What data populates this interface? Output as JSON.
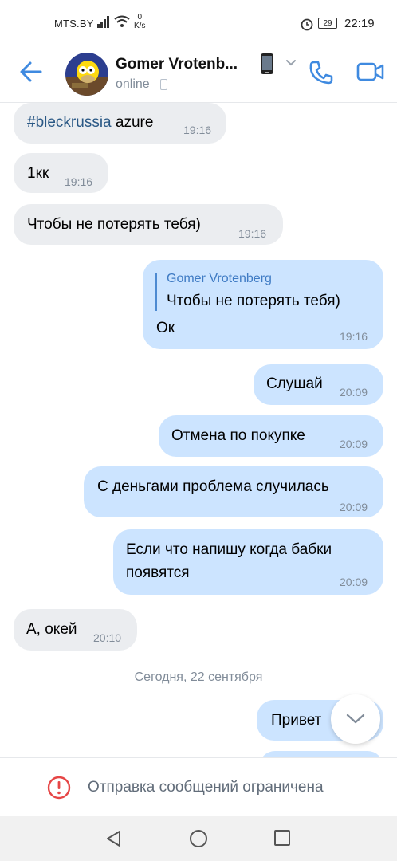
{
  "status_bar": {
    "carrier": "MTS.BY",
    "net_speed_value": "0",
    "net_speed_unit": "K/s",
    "battery": "29",
    "time": "22:19"
  },
  "header": {
    "contact_name": "Gomer Vrotenb...",
    "status": "online",
    "icons": [
      "back-arrow-icon",
      "phone-emoji-icon",
      "chevron-down-icon",
      "call-icon",
      "video-call-icon"
    ]
  },
  "messages": [
    {
      "dir": "in",
      "hashtag": "#bleckrussia",
      "text": " azure",
      "time": "19:16"
    },
    {
      "dir": "in",
      "text": "1кк",
      "time": "19:16"
    },
    {
      "dir": "in",
      "text": "Чтобы не потерять тебя)",
      "time": "19:16"
    },
    {
      "dir": "out",
      "reply_author": "Gomer Vrotenberg",
      "reply_text": "Чтобы не потерять тебя)",
      "text": "Ок",
      "time": "19:16"
    },
    {
      "dir": "out",
      "text": "Слушай",
      "time": "20:09"
    },
    {
      "dir": "out",
      "text": "Отмена по покупке",
      "time": "20:09"
    },
    {
      "dir": "out",
      "text": "С деньгами проблема случилась",
      "time": "20:09"
    },
    {
      "dir": "out",
      "text": "Если что напишу когда бабки",
      "text_line2": "появятся",
      "time": "20:09"
    },
    {
      "dir": "in",
      "text": "А, окей",
      "time": "20:10"
    },
    {
      "dir": "out",
      "text": "Привет"
    }
  ],
  "date_separator": "Сегодня, 22 сентября",
  "restriction_notice": "Отправка сообщений ограничена",
  "colors": {
    "incoming_bubble": "#ebedf0",
    "outgoing_bubble": "#cce4ff",
    "accent": "#3f8ae0",
    "warning": "#e64646"
  }
}
